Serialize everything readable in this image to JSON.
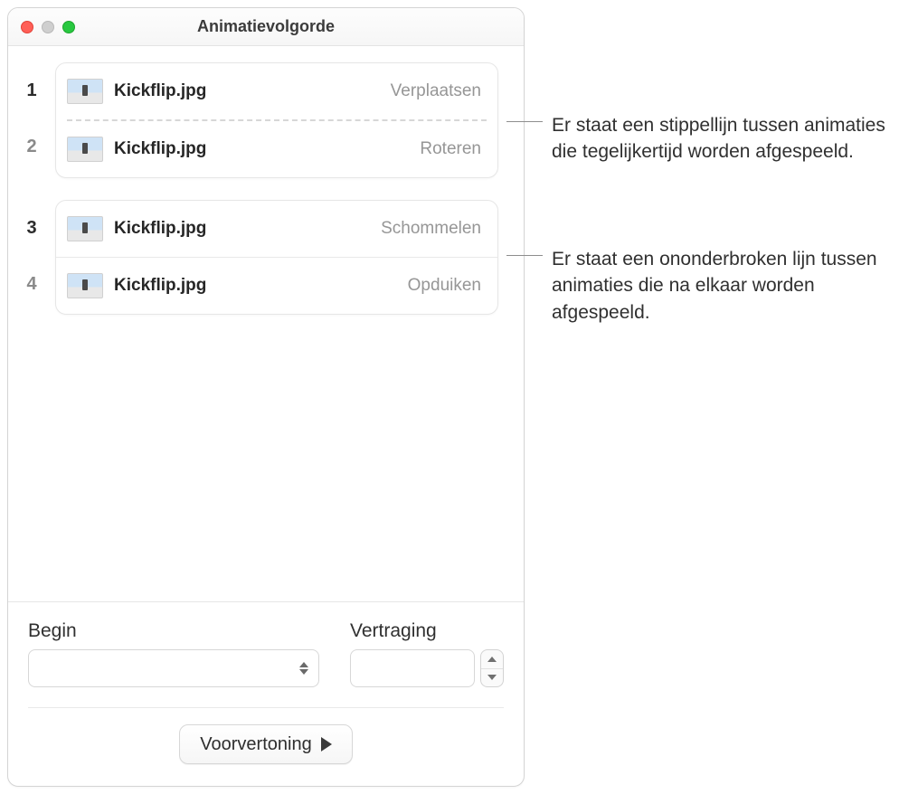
{
  "window": {
    "title": "Animatievolgorde"
  },
  "animations": {
    "group1": [
      {
        "index": "1",
        "index_dim": false,
        "file": "Kickflip.jpg",
        "effect": "Verplaatsen"
      },
      {
        "index": "2",
        "index_dim": true,
        "file": "Kickflip.jpg",
        "effect": "Roteren"
      }
    ],
    "group2": [
      {
        "index": "3",
        "index_dim": false,
        "file": "Kickflip.jpg",
        "effect": "Schommelen"
      },
      {
        "index": "4",
        "index_dim": true,
        "file": "Kickflip.jpg",
        "effect": "Opduiken"
      }
    ]
  },
  "controls": {
    "begin_label": "Begin",
    "delay_label": "Vertraging",
    "begin_value": "",
    "delay_value": "",
    "preview_label": "Voorvertoning"
  },
  "callouts": {
    "dashed": "Er staat een stippellijn tussen animaties die tegelijkertijd worden afgespeeld.",
    "solid": "Er staat een ononderbroken lijn tussen animaties die na elkaar worden afgespeeld."
  }
}
